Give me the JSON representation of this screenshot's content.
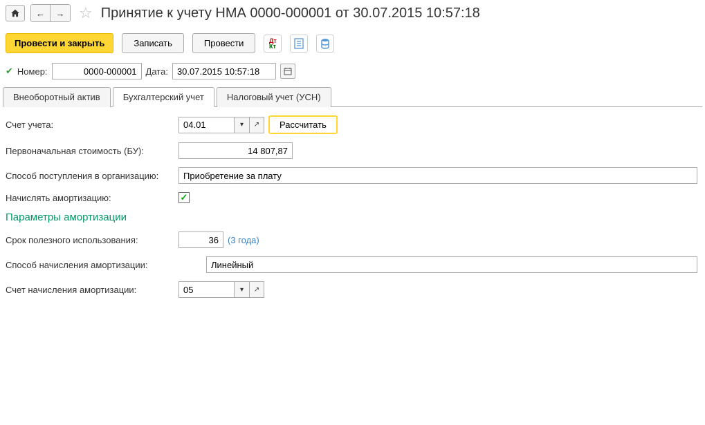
{
  "header": {
    "title": "Принятие к учету НМА 0000-000001 от 30.07.2015 10:57:18"
  },
  "toolbar": {
    "post_close": "Провести и закрыть",
    "save": "Записать",
    "post": "Провести"
  },
  "fields": {
    "number_label": "Номер:",
    "number_value": "0000-000001",
    "date_label": "Дата:",
    "date_value": "30.07.2015 10:57:18"
  },
  "tabs": {
    "t1": "Внеоборотный актив",
    "t2": "Бухгалтерский учет",
    "t3": "Налоговый учет (УСН)"
  },
  "form": {
    "account_label": "Счет учета:",
    "account_value": "04.01",
    "calc_btn": "Рассчитать",
    "cost_label": "Первоначальная стоимость (БУ):",
    "cost_value": "14 807,87",
    "receipt_label": "Способ поступления в организацию:",
    "receipt_value": "Приобретение за плату",
    "amort_flag_label": "Начислять амортизацию:",
    "section_title": "Параметры амортизации",
    "useful_life_label": "Срок полезного использования:",
    "useful_life_value": "36",
    "useful_life_hint": "(3 года)",
    "method_label": "Способ начисления амортизации:",
    "method_value": "Линейный",
    "amort_account_label": "Счет начисления амортизации:",
    "amort_account_value": "05"
  }
}
